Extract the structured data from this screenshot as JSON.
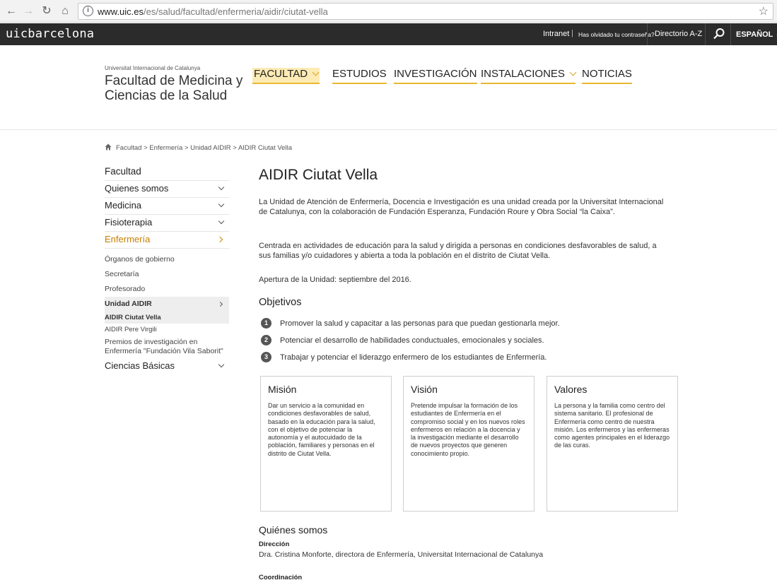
{
  "browser": {
    "url_host": "www.uic.es",
    "url_path": "/es/salud/facultad/enfermeria/aidir/ciutat-vella"
  },
  "topbar": {
    "logo": "uicbarcelona",
    "intranet": "Intranet",
    "separator": "|",
    "forgot_password": "Has olvidado tu contraseña?",
    "directory": "Directorio A-Z",
    "language": "ESPAÑOL"
  },
  "header": {
    "university": "Universitat Internacional de Catalunya",
    "faculty_title": "Facultad de Medicina y Ciencias de la Salud",
    "nav": [
      {
        "label": "FACULTAD"
      },
      {
        "label": "ESTUDIOS"
      },
      {
        "label": "INVESTIGACIÓN"
      },
      {
        "label": "INSTALACIONES"
      },
      {
        "label": "NOTICIAS"
      }
    ]
  },
  "breadcrumb": "Facultad >  Enfermería >  Unidad AIDIR >  AIDIR Ciutat Vella",
  "sidebar": {
    "heading": "Facultad",
    "items": [
      {
        "label": "Quienes somos"
      },
      {
        "label": "Medicina"
      },
      {
        "label": "Fisioterapia"
      },
      {
        "label": "Enfermería"
      }
    ],
    "sub": [
      {
        "label": "Órganos de gobierno"
      },
      {
        "label": "Secretaría"
      },
      {
        "label": "Profesorado"
      },
      {
        "label": "Unidad AIDIR"
      }
    ],
    "sub3": [
      {
        "label": "AIDIR Ciutat Vella"
      },
      {
        "label": "AIDIR Pere Virgili"
      }
    ],
    "premios": "Premios de investigación en Enfermería \"Fundación Vila Saborit\"",
    "last": "Ciencias Básicas"
  },
  "main": {
    "title": "AIDIR Ciutat Vella",
    "p1": "La Unidad de Atención de Enfermería, Docencia e Investigación es una unidad creada por la Universitat Internacional de Catalunya, con la colaboración de Fundación Esperanza, Fundación Roure y Obra Social “la Caixa”.",
    "p2": "Centrada en actividades de educación para la salud y dirigida a personas en condiciones desfavorables de salud, a sus familias y/o cuidadores y abierta a toda la población en el distrito de Ciutat Vella.",
    "p3": "Apertura de la Unidad: septiembre del 2016.",
    "objectives_title": "Objetivos",
    "objectives": [
      {
        "num": "1",
        "text": "Promover la salud y capacitar a las personas para que puedan gestionarla mejor."
      },
      {
        "num": "2",
        "text": "Potenciar el desarrollo de habilidades conductuales, emocionales y sociales."
      },
      {
        "num": "3",
        "text": "Trabajar y potenciar el liderazgo enfermero de los estudiantes de Enfermería."
      }
    ],
    "cards": [
      {
        "title": "Misión",
        "text": "Dar un servicio a la comunidad en condiciones desfavorables de salud, basado en la educación para la salud, con el objetivo de potenciar la autonomía y el autocuidado de la población, familiares y personas en el distrito de Ciutat Vella."
      },
      {
        "title": "Visión",
        "text": "Pretende impulsar la formación de los estudiantes de Enfermería en el compromiso social y en los nuevos roles enfermeros en relación a la docencia y la investigación mediante el desarrollo de nuevos proyectos que generen conocimiento propio."
      },
      {
        "title": "Valores",
        "text": "La persona y la familia como centro del sistema sanitario. El profesional de Enfermería como centro de nuestra misión. Los enfermeros y las enfermeras como agentes principales en el liderazgo de las curas."
      }
    ],
    "quienes_title": "Quiénes somos",
    "direccion_label": "Dirección",
    "direccion_text": "Dra. Cristina Monforte, directora de Enfermería, Universitat Internacional de Catalunya",
    "coordinacion_label": "Coordinación"
  }
}
